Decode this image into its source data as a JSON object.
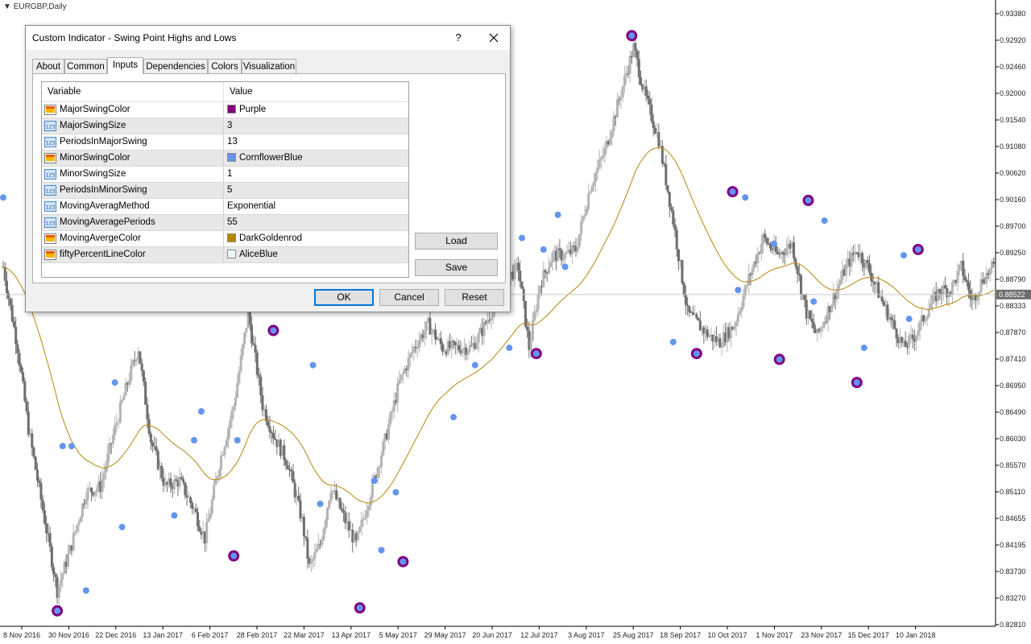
{
  "chart": {
    "symbol": "EURGBP,Daily",
    "current_price_label": "0.88522",
    "price_ticks": [
      "0.93380",
      "0.92920",
      "0.92460",
      "0.92000",
      "0.91540",
      "0.91080",
      "0.90620",
      "0.90160",
      "0.89700",
      "0.89250",
      "0.88790",
      "0.88333",
      "0.87870",
      "0.87410",
      "0.86950",
      "0.86490",
      "0.86030",
      "0.85570",
      "0.85110",
      "0.84655",
      "0.84195",
      "0.83730",
      "0.83270",
      "0.82810"
    ],
    "date_ticks": [
      "8 Nov 2016",
      "30 Nov 2016",
      "22 Dec 2016",
      "13 Jan 2017",
      "6 Feb 2017",
      "28 Feb 2017",
      "22 Mar 2017",
      "13 Apr 2017",
      "5 May 2017",
      "29 May 2017",
      "20 Jun 2017",
      "12 Jul 2017",
      "3 Aug 2017",
      "25 Aug 2017",
      "18 Sep 2017",
      "10 Oct 2017",
      "1 Nov 2017",
      "23 Nov 2017",
      "15 Dec 2017",
      "10 Jan 2018"
    ],
    "colors": {
      "major_swing": "#800080",
      "minor_swing": "#6495ed",
      "moving_average": "#b8860b",
      "bull_candle": "#b4b4b4",
      "bear_candle": "#6e6e6e",
      "axis": "#000000"
    }
  },
  "dialog": {
    "title": "Custom Indicator - Swing Point Highs and Lows",
    "help_label": "?",
    "tabs": [
      {
        "label": "About",
        "active": false
      },
      {
        "label": "Common",
        "active": false
      },
      {
        "label": "Inputs",
        "active": true
      },
      {
        "label": "Dependencies",
        "active": false
      },
      {
        "label": "Colors",
        "active": false
      },
      {
        "label": "Visualization",
        "active": false
      }
    ],
    "grid": {
      "header_variable": "Variable",
      "header_value": "Value",
      "rows": [
        {
          "variable": "MajorSwingColor",
          "value": "Purple",
          "icon": "color-icon",
          "swatch": "#800080"
        },
        {
          "variable": "MajorSwingSize",
          "value": "3",
          "icon": "number-icon"
        },
        {
          "variable": "PeriodsInMajorSwing",
          "value": "13",
          "icon": "number-icon"
        },
        {
          "variable": "MinorSwingColor",
          "value": "CornflowerBlue",
          "icon": "color-icon",
          "swatch": "#6495ed"
        },
        {
          "variable": "MinorSwingSize",
          "value": "1",
          "icon": "number-icon"
        },
        {
          "variable": "PeriodsInMinorSwing",
          "value": "5",
          "icon": "number-icon"
        },
        {
          "variable": "MovingAveragMethod",
          "value": "Exponential",
          "icon": "number-icon"
        },
        {
          "variable": "MovingAveragePeriods",
          "value": "55",
          "icon": "number-icon"
        },
        {
          "variable": "MovingAvergeColor",
          "value": "DarkGoldenrod",
          "icon": "color-icon",
          "swatch": "#b8860b"
        },
        {
          "variable": "fiftyPercentLineColor",
          "value": "AliceBlue",
          "icon": "color-icon",
          "swatch": "#f0f8ff"
        }
      ]
    },
    "buttons": {
      "load": "Load",
      "save": "Save",
      "ok": "OK",
      "cancel": "Cancel",
      "reset": "Reset"
    }
  }
}
